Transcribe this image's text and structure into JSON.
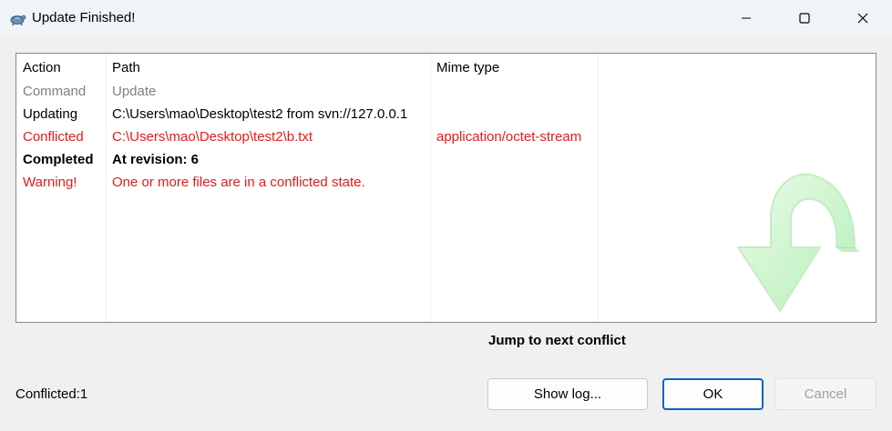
{
  "window": {
    "title": "Update Finished!",
    "app_icon": "tortoise-icon",
    "controls": [
      "minimize-icon",
      "maximize-icon",
      "close-icon"
    ]
  },
  "list": {
    "columns": [
      "Action",
      "Path",
      "Mime type"
    ],
    "rows": [
      {
        "action": "Command",
        "path": "Update",
        "mime": "",
        "style": "gray"
      },
      {
        "action": "Updating",
        "path": "C:\\Users\\mao\\Desktop\\test2 from svn://127.0.0.1",
        "mime": "",
        "style": "normal"
      },
      {
        "action": "Conflicted",
        "path": "C:\\Users\\mao\\Desktop\\test2\\b.txt",
        "mime": "application/octet-stream",
        "style": "red"
      },
      {
        "action": "Completed",
        "path": "At revision: 6",
        "mime": "",
        "style": "bold"
      },
      {
        "action": "Warning!",
        "path": "One or more files are in a conflicted state.",
        "mime": "",
        "style": "red"
      }
    ],
    "watermark_icon": "curved-arrow-down-icon"
  },
  "jump_label": "Jump to next conflict",
  "status_text": "Conflicted:1",
  "buttons": {
    "show_log": "Show log...",
    "ok": "OK",
    "cancel": "Cancel"
  },
  "colors": {
    "conflict_red": "#e31b1b",
    "command_gray": "#808080",
    "titlebar_bg": "#eff4f9",
    "ok_border": "#0a63c9"
  }
}
